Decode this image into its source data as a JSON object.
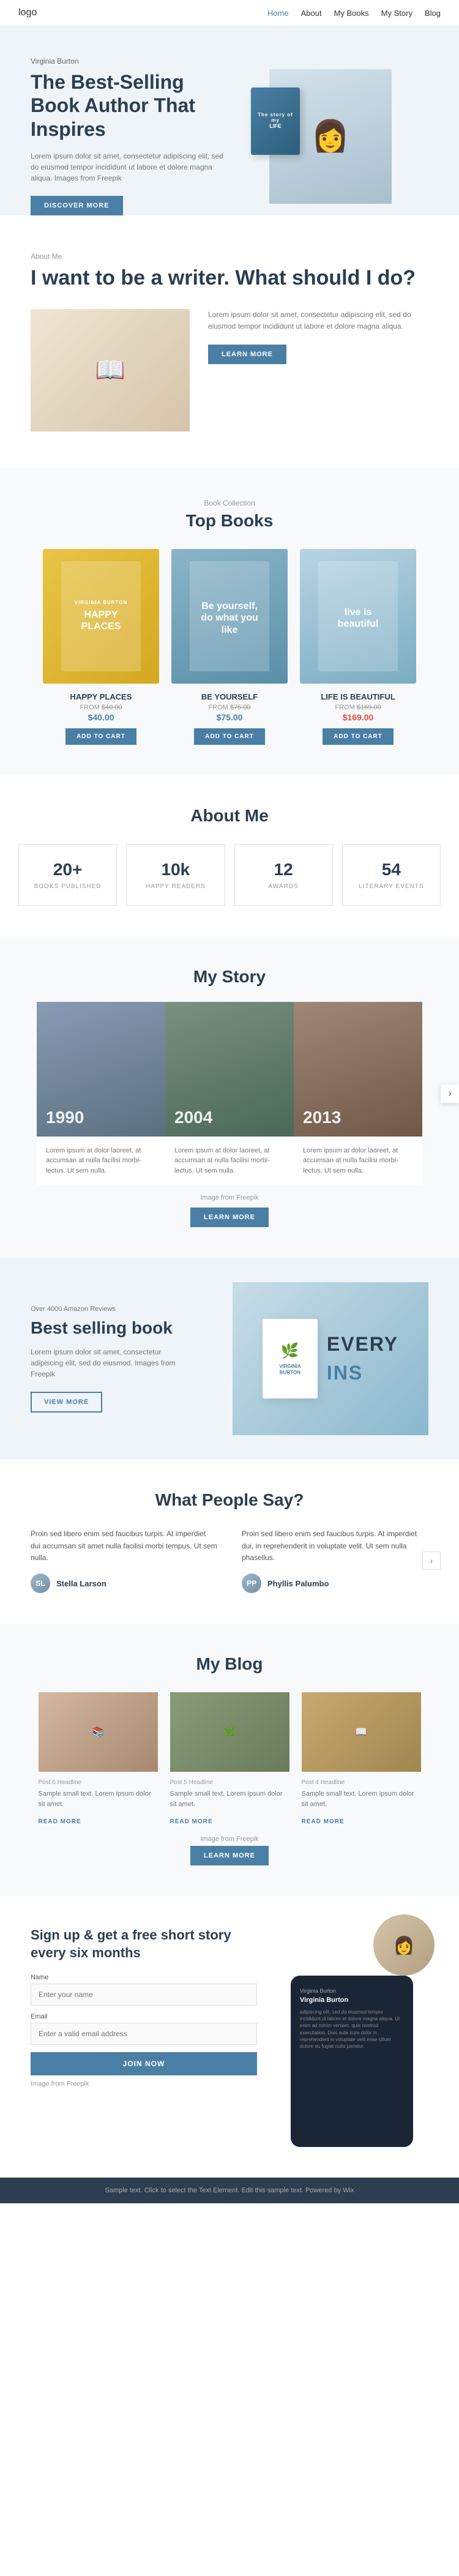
{
  "nav": {
    "logo": "logo",
    "links": [
      {
        "label": "Home",
        "active": true
      },
      {
        "label": "About"
      },
      {
        "label": "My Books"
      },
      {
        "label": "My Story"
      },
      {
        "label": "Blog"
      }
    ]
  },
  "hero": {
    "subtitle": "Virginia Burton",
    "title": "The Best-Selling Book Author That Inspires",
    "text": "Lorem ipsum dolor sit amet, consectetur adipiscing elit, sed do eiusmod tempor incididunt ut labore et dolore magna aliqua. Images from Freepik",
    "cta": "DISCOVER MORE",
    "book_label": "The story of my",
    "book_title": "LIFE"
  },
  "about": {
    "label": "About Me",
    "title": "I want to be a writer. What should I do?",
    "text": "Lorem ipsum dolor sit amet, consectetur adipiscing elit, sed do eiusmod tempor incididunt ut labore et dolore magna aliqua.",
    "cta": "LEARN MORE"
  },
  "books": {
    "section_label": "Book Collection",
    "section_title": "Top Books",
    "items": [
      {
        "name": "HAPPY PLACES",
        "cover_author": "VIRGINIA BURTON",
        "cover_title": "HAPPY PLACES",
        "price_from": "$40.00",
        "price": "$40.00",
        "on_sale": false,
        "add_to_cart": "ADD TO CART"
      },
      {
        "name": "BE YOURSELF",
        "cover_author": "",
        "cover_title": "Be yourself, do what you like",
        "price_from": "$75.00",
        "price": "$75.00",
        "on_sale": false,
        "add_to_cart": "ADD TO CART"
      },
      {
        "name": "LIFE IS BEAUTIFUL",
        "cover_author": "",
        "cover_title": "live is beautiful",
        "price_from": "$169.00",
        "price": "$169.00",
        "on_sale": true,
        "add_to_cart": "ADD TO CART"
      }
    ]
  },
  "stats": {
    "title": "About Me",
    "items": [
      {
        "number": "20+",
        "label": "BOOKS PUBLISHED"
      },
      {
        "number": "10k",
        "label": "HAPPY READERS"
      },
      {
        "number": "12",
        "label": "AWARDS"
      },
      {
        "number": "54",
        "label": "LITERARY EVENTS"
      }
    ]
  },
  "story": {
    "title": "My Story",
    "slides": [
      {
        "year": "1990",
        "text": "Lorem ipsum at dolor laoreet, at accumsan at nulla facilisi morbi-lectus. Ut sem nulla."
      },
      {
        "year": "2004",
        "text": "Lorem ipsum at dolor laoreet, at accumsan at nulla facilisi morbi-lectus. Ut sem nulla."
      },
      {
        "year": "2013",
        "text": "Lorem ipsum at dolor laoreet, at accumsan at nulla facilisi morbi-lectus. Ut sem nulla."
      }
    ],
    "caption": "Image from Freepik",
    "cta": "LEARN MORE"
  },
  "bestsell": {
    "reviews": "Over 4000 Amazon Reviews",
    "title": "Best selling book",
    "text": "Lorem ipsum dolor sit amet, consectetur adipiscing elit, sed do eiusmod. Images from Freepik",
    "cta": "VIEW MORE",
    "book_line1": "EVERY",
    "book_line2": "INS",
    "book_author": "VIRGINIA BURTON",
    "book_full_title": "EVERYTHING INSIDE YOU"
  },
  "testimonials": {
    "title": "What People Say?",
    "items": [
      {
        "text": "Proin sed libero enim sed faucibus turpis. At imperdiet dui accumsan sit amet nulla facilisi morbi tempus. Ut sem nulla.",
        "author": "Stella Larson",
        "initials": "SL"
      },
      {
        "text": "Proin sed libero enim sed faucibus turpis. At imperdiet dui, in reprehenderit in voluptate velit. Ut sem nulla phasellus.",
        "author": "Phyllis Palumbo",
        "initials": "PP"
      }
    ]
  },
  "blog": {
    "title": "My Blog",
    "posts": [
      {
        "label": "Post 6 Headline",
        "text": "Sample small text. Lorem ipsum dolor sit amet.",
        "read_more": "READ MORE"
      },
      {
        "label": "Post 5 Headline",
        "text": "Sample small text. Lorem ipsum dolor sit amet.",
        "read_more": "READ MORE"
      },
      {
        "label": "Post 4 Headline",
        "text": "Sample small text. Lorem ipsum dolor sit amet.",
        "read_more": "READ MORE"
      }
    ],
    "caption": "Image from Freepik",
    "cta": "LEARN MORE"
  },
  "signup": {
    "title": "Sign up & get a free short story every six months",
    "form": {
      "name_label": "Name",
      "name_placeholder": "Enter your name",
      "email_label": "Email",
      "email_placeholder": "Enter a valid email address",
      "cta": "JOIN NOW",
      "caption": "Image from Freepik"
    },
    "device": {
      "author": "Virginia Burton",
      "name_line": "Virginia Burton",
      "text": "adipiscing elit, sed do eiusmod tempor incididunt ut labore et dolore magna aliqua. Ut enim ad minim veniam, quis nostrud exercitation. Duis aute irure dolor in reprehenderit in voluptate velit esse cillum dolore eu fugiat nulla pariatur."
    }
  },
  "footer": {
    "text": "Sample text. Click to select the Text Element. Edit this sample text.",
    "link_text": "Powered by Wix"
  }
}
